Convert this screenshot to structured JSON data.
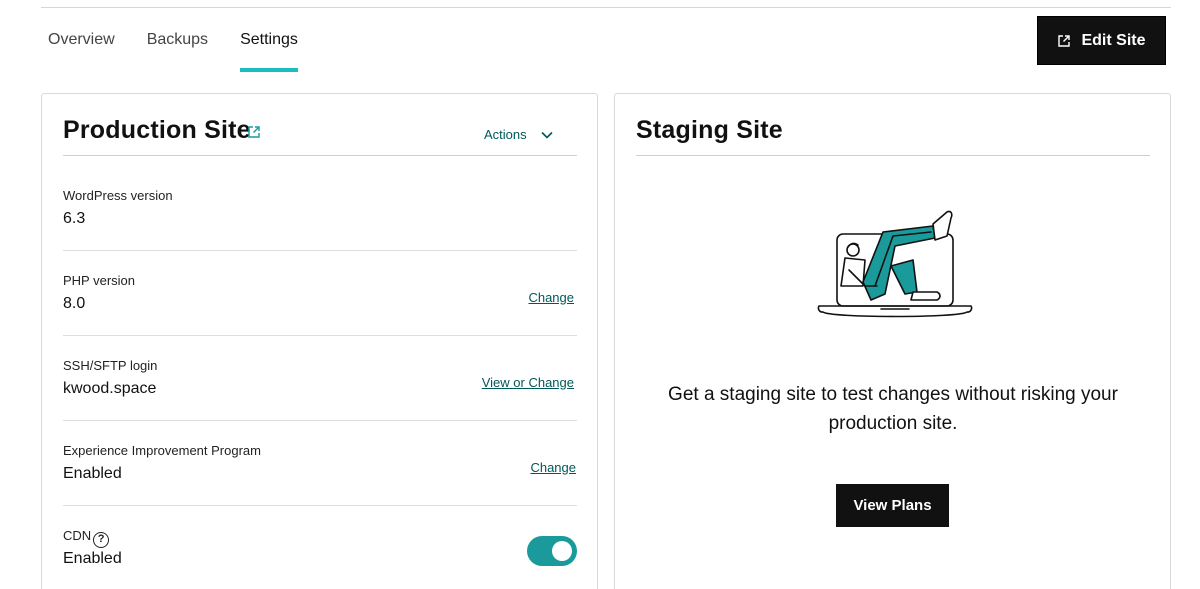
{
  "tabs": [
    {
      "label": "Overview"
    },
    {
      "label": "Backups"
    },
    {
      "label": "Settings"
    }
  ],
  "active_tab": "Settings",
  "header": {
    "edit_site_label": "Edit Site"
  },
  "production": {
    "title": "Production Site",
    "actions_label": "Actions",
    "rows": [
      {
        "label": "WordPress version",
        "value": "6.3"
      },
      {
        "label": "PHP version",
        "value": "8.0",
        "link": "Change"
      },
      {
        "label": "SSH/SFTP login",
        "value": "kwood.space",
        "link": "View or Change"
      },
      {
        "label": "Experience Improvement Program",
        "value": "Enabled",
        "link": "Change"
      },
      {
        "label": "CDN",
        "value": "Enabled",
        "toggle_on": true
      }
    ]
  },
  "staging": {
    "title": "Staging Site",
    "description": "Get a staging site to test changes without risking your production site.",
    "button_label": "View Plans"
  },
  "colors": {
    "accent": "#1bbdc1",
    "toggle": "#1b9a9c",
    "link": "#00585a"
  }
}
